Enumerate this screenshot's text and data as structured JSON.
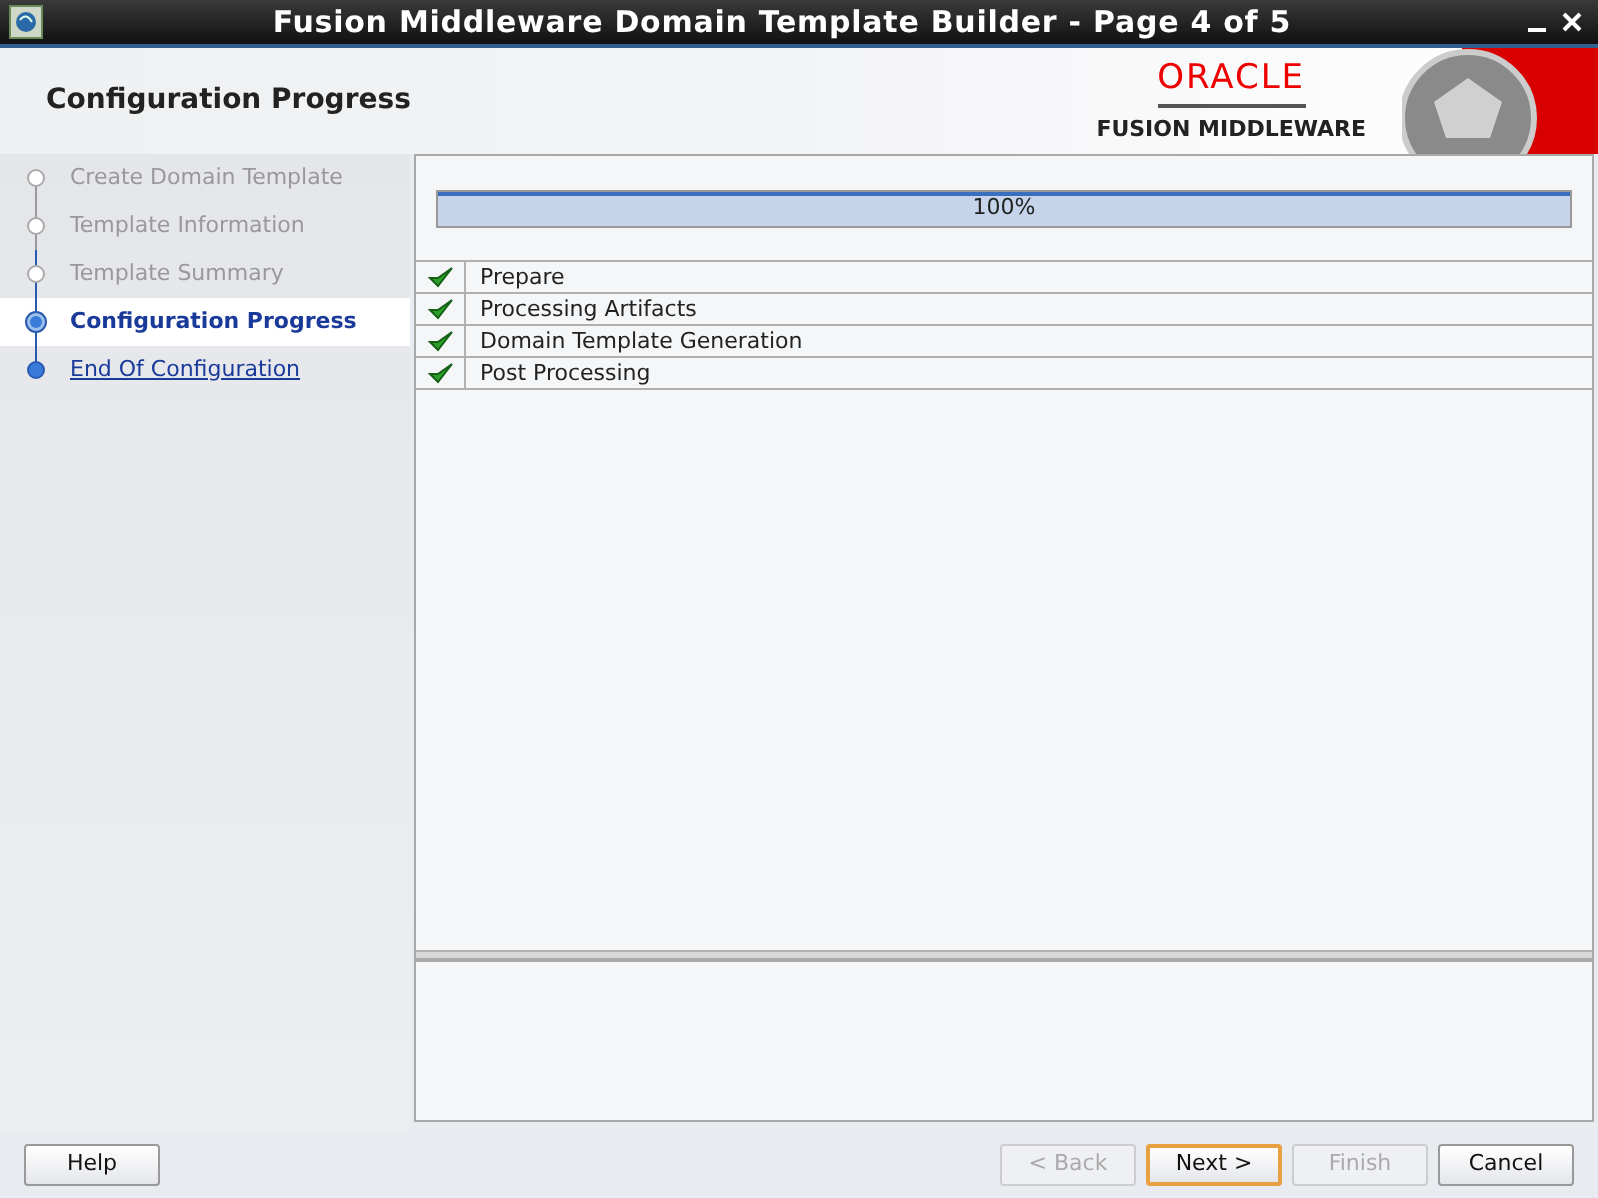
{
  "window": {
    "title": "Fusion Middleware Domain Template Builder - Page 4 of 5"
  },
  "header": {
    "title": "Configuration Progress",
    "brand": "ORACLE",
    "product": "FUSION MIDDLEWARE"
  },
  "steps": [
    {
      "label": "Create Domain Template",
      "kind": "visited",
      "selected": false
    },
    {
      "label": "Template Information",
      "kind": "visited",
      "selected": false
    },
    {
      "label": "Template Summary",
      "kind": "visited",
      "selected": false
    },
    {
      "label": "Configuration Progress",
      "kind": "current",
      "selected": true
    },
    {
      "label": "End Of Configuration",
      "kind": "link",
      "selected": false
    }
  ],
  "progress": {
    "level": 1,
    "reading": "100%"
  },
  "tasks": [
    {
      "label": "Prepare",
      "checked": true
    },
    {
      "label": "Processing Artifacts",
      "checked": true
    },
    {
      "label": "Domain Template Generation",
      "checked": true
    },
    {
      "label": "Post Processing",
      "checked": true
    }
  ],
  "buttons_left": [
    {
      "label": "Help",
      "disabled": false,
      "default": false
    }
  ],
  "buttons_right": [
    {
      "label": "< Back",
      "disabled": true,
      "default": false
    },
    {
      "label": "Next >",
      "disabled": false,
      "default": true
    },
    {
      "label": "Finish",
      "disabled": true,
      "default": false
    },
    {
      "label": "Cancel",
      "disabled": false,
      "default": false
    }
  ]
}
